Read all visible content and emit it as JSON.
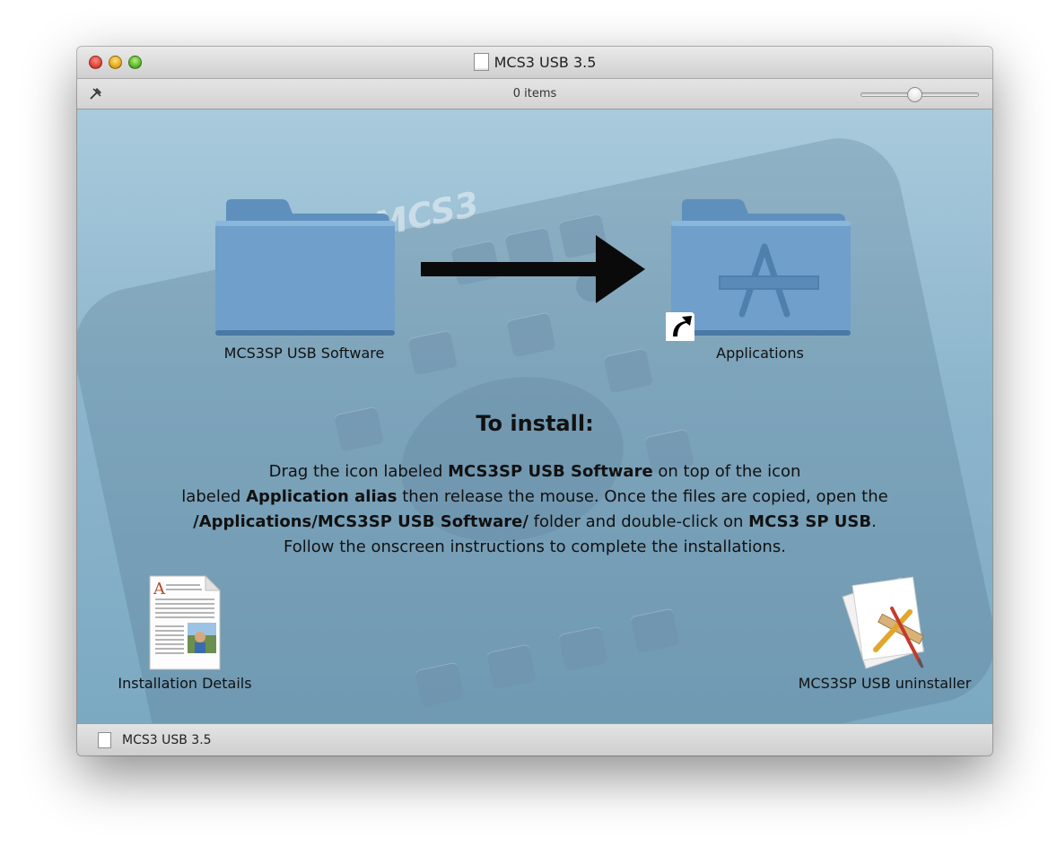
{
  "window": {
    "title": "MCS3 USB 3.5",
    "icon": "disk-image-document-icon"
  },
  "toolbar": {
    "items_count": "0 items",
    "icon_size_slider": 0.45
  },
  "background": {
    "brand": "MCS3"
  },
  "icons": {
    "software_folder": {
      "label": "MCS3SP USB Software",
      "icon": "folder-icon"
    },
    "applications": {
      "label": "Applications",
      "icon": "applications-folder-alias-icon"
    },
    "installation_details": {
      "label": "Installation Details",
      "icon": "document-icon"
    },
    "uninstaller": {
      "label": "MCS3SP USB uninstaller",
      "icon": "script-app-icon"
    }
  },
  "instructions": {
    "heading": "To install:",
    "l1_a": "Drag the icon labeled ",
    "l1_b": "MCS3SP USB Software",
    "l1_c": " on top of the icon",
    "l2_a": "labeled ",
    "l2_b": "Application alias",
    "l2_c": " then release the mouse. Once the files are copied, open the",
    "l3_a": "/Applications/MCS3SP USB Software/",
    "l3_b": " folder and double-click on ",
    "l3_c": "MCS3 SP USB",
    "l3_d": ".",
    "l4": "Follow the onscreen instructions to complete the installations."
  },
  "statusbar": {
    "path": "MCS3 USB 3.5"
  },
  "colors": {
    "folder_blue": "#6f9fca",
    "content_bg": "#8db6cd"
  }
}
